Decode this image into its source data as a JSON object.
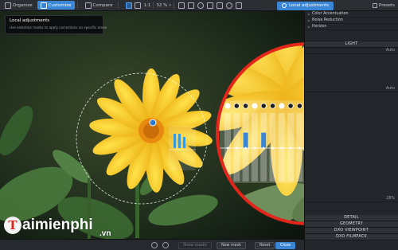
{
  "toolbar": {
    "organize_label": "Organize",
    "customize_label": "Customize",
    "compare_label": "Compare",
    "ratio_label": "1:1",
    "zoom_label": "32 %",
    "local_adjustments_label": "Local adjustments",
    "presets_label": "Presets"
  },
  "tooltip": {
    "title": "Local adjustments",
    "body": "Use selective masks to apply corrections on specific areas"
  },
  "palette": {
    "top_items": [
      {
        "label": "Color Accentuation"
      },
      {
        "label": "Noise Reduction"
      },
      {
        "label": "Horizon"
      }
    ],
    "section_light": "LIGHT",
    "row_auto_1": "Auto",
    "row_auto_2": "Auto",
    "zoom_value": "28%",
    "bottom_sections": [
      "DETAIL",
      "GEOMETRY",
      "DXO VIEWPOINT",
      "DXO FILMPACK"
    ]
  },
  "bottombar": {
    "show_masks_label": "Show masks",
    "new_mask_label": "New mask",
    "reset_label": "Reset",
    "close_label": "Close"
  },
  "logo": {
    "text": "aimienphi",
    "suffix": ".vn",
    "letter": "T"
  },
  "colors": {
    "accent": "#3a86d6",
    "magnifier_ring": "#e2261b",
    "flower": "#f5c518"
  },
  "icons": [
    "grid-icon",
    "undo-icon",
    "redo-icon",
    "gear-icon",
    "eye-icon",
    "brush-icon",
    "gradient-icon",
    "eraser-icon",
    "reset-icon"
  ],
  "local_adjustment_controls": {
    "slider_levels": [
      0.0,
      0.0,
      0.55,
      0.0,
      0.55,
      0.0,
      0.0,
      0.0,
      0.0,
      0.0,
      0.0,
      0.0,
      0.0,
      0.3,
      0.0,
      0.55,
      0.0
    ]
  }
}
